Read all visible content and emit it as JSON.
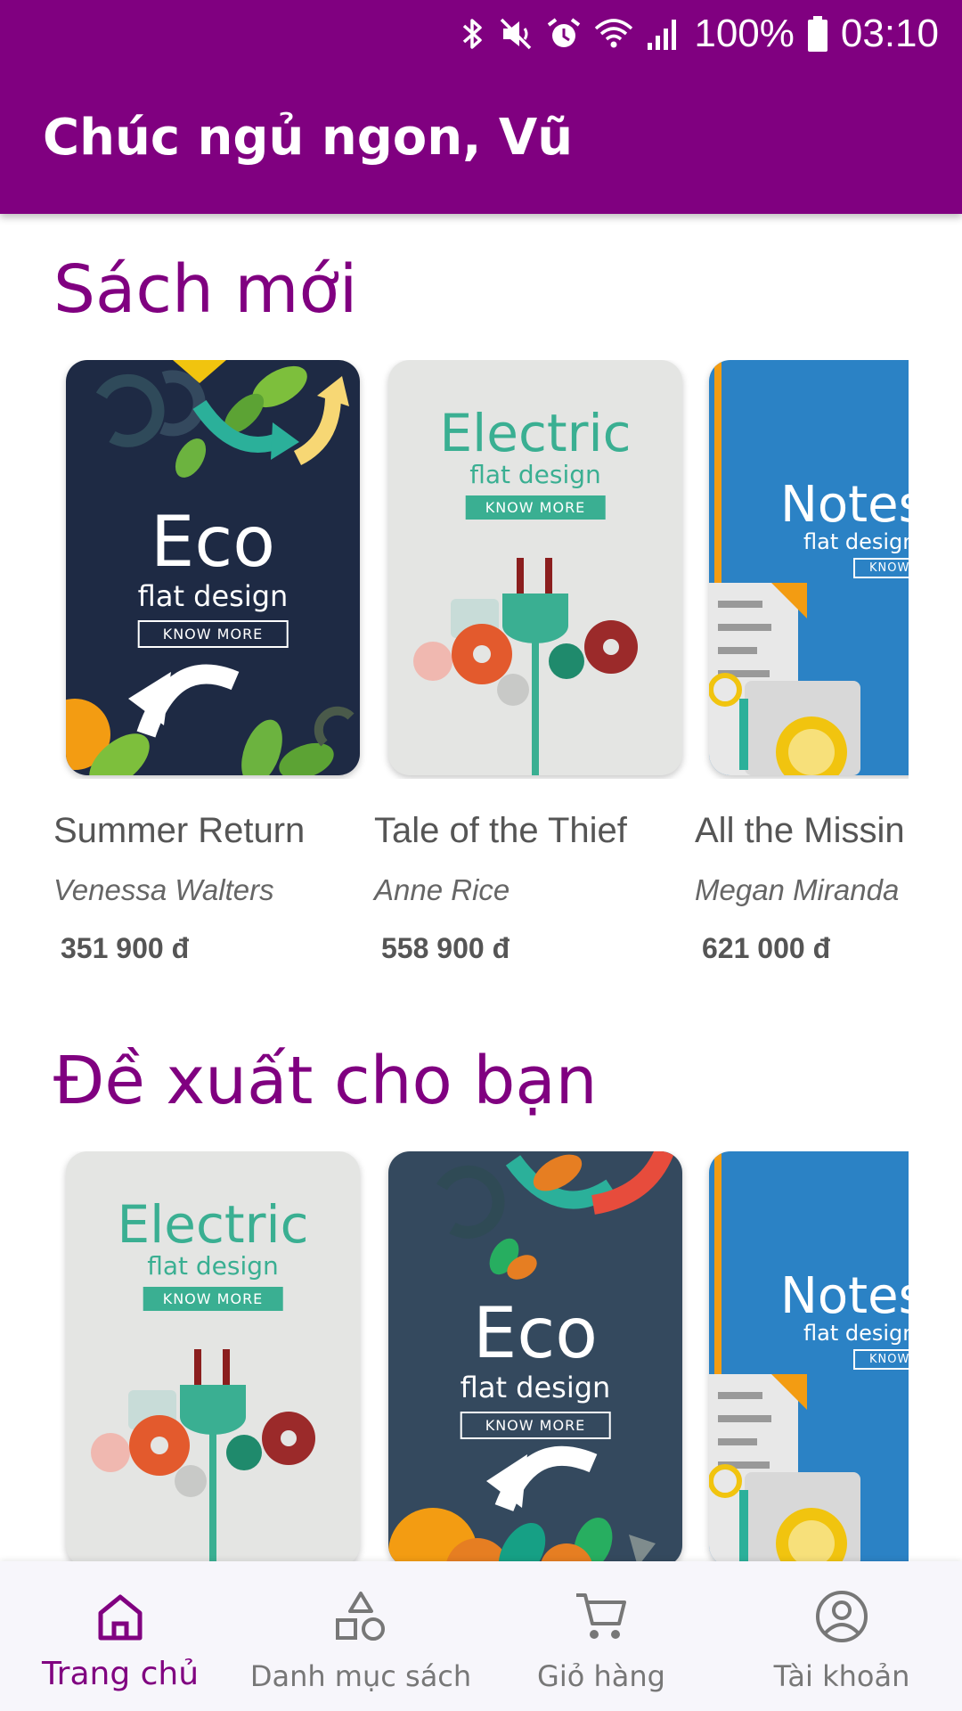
{
  "status_bar": {
    "battery": "100%",
    "time": "03:10"
  },
  "header": {
    "greeting": "Chúc ngủ ngon, Vũ"
  },
  "sections": [
    {
      "title": "Sách mới",
      "books": [
        {
          "title": "Summer Return",
          "author": "Venessa Walters",
          "price": "351 900 đ",
          "cover": {
            "theme": "eco-dark",
            "headline": "Eco",
            "sub": "flat design",
            "button": "KNOW MORE"
          }
        },
        {
          "title": "Tale of the Thief",
          "author": "Anne Rice",
          "price": "558 900 đ",
          "cover": {
            "theme": "electric",
            "headline": "Electric",
            "sub": "flat design",
            "button": "KNOW MORE"
          }
        },
        {
          "title": "All the Missin",
          "author": "Megan Miranda",
          "price": "621 000 đ",
          "cover": {
            "theme": "notes",
            "headline": "Notes",
            "sub": "flat design",
            "button": "KNOW MORE"
          }
        }
      ]
    },
    {
      "title": "Đề xuất cho bạn",
      "books": [
        {
          "cover": {
            "theme": "electric",
            "headline": "Electric",
            "sub": "flat design",
            "button": "KNOW MORE"
          }
        },
        {
          "cover": {
            "theme": "eco-slate",
            "headline": "Eco",
            "sub": "flat design",
            "button": "KNOW MORE"
          }
        },
        {
          "cover": {
            "theme": "notes",
            "headline": "Notes",
            "sub": "flat design",
            "button": "KNOW MORE"
          }
        }
      ]
    }
  ],
  "bottom_nav": [
    {
      "label": "Trang chủ",
      "icon": "home-icon",
      "active": true
    },
    {
      "label": "Danh mục sách",
      "icon": "category-shapes-icon",
      "active": false
    },
    {
      "label": "Giỏ hàng",
      "icon": "cart-icon",
      "active": false
    },
    {
      "label": "Tài khoản",
      "icon": "account-icon",
      "active": false
    }
  ],
  "colors": {
    "primary": "#800080",
    "eco_dark_bg": "#1e2a44",
    "eco_slate_bg": "#34495e",
    "electric_bg": "#e4e5e3",
    "electric_teal": "#3aaf92",
    "notes_bg": "#2b82c5"
  }
}
